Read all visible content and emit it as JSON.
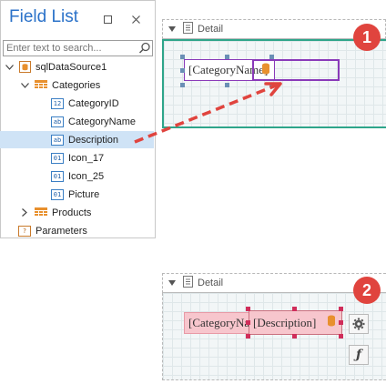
{
  "field_list": {
    "title": "Field List",
    "search_placeholder": "Enter text to search...",
    "tree": [
      {
        "label": "sqlDataSource1",
        "icon": "datasource-icon",
        "type": "datasource"
      },
      {
        "label": "Categories",
        "icon": "table-icon",
        "type": "table"
      },
      {
        "label": "CategoryID",
        "icon": "number-field-icon",
        "type_label": "12"
      },
      {
        "label": "CategoryName",
        "icon": "string-field-icon",
        "type_label": "ab"
      },
      {
        "label": "Description",
        "icon": "string-field-icon",
        "type_label": "ab"
      },
      {
        "label": "Icon_17",
        "icon": "binary-field-icon",
        "type_label": "01"
      },
      {
        "label": "Icon_25",
        "icon": "binary-field-icon",
        "type_label": "01"
      },
      {
        "label": "Picture",
        "icon": "binary-field-icon",
        "type_label": "01"
      },
      {
        "label": "Products",
        "icon": "table-icon",
        "type": "table"
      },
      {
        "label": "Parameters",
        "icon": "parameters-icon",
        "type_label": "?"
      }
    ]
  },
  "band1": {
    "title": "Detail",
    "label_text": "[CategoryName]",
    "badge": "1"
  },
  "band2": {
    "title": "Detail",
    "label1_text": "[CategoryName]",
    "label2_text": "[Description]",
    "badge": "2"
  },
  "colors": {
    "title_blue": "#2b72c9",
    "selection": "#cfe3f6",
    "drop_target": "#2ea58a",
    "arrow": "#e0443e",
    "badge": "#e0443e",
    "label_purple": "#8a3ab9",
    "label_pink": "#f7c6cd"
  }
}
